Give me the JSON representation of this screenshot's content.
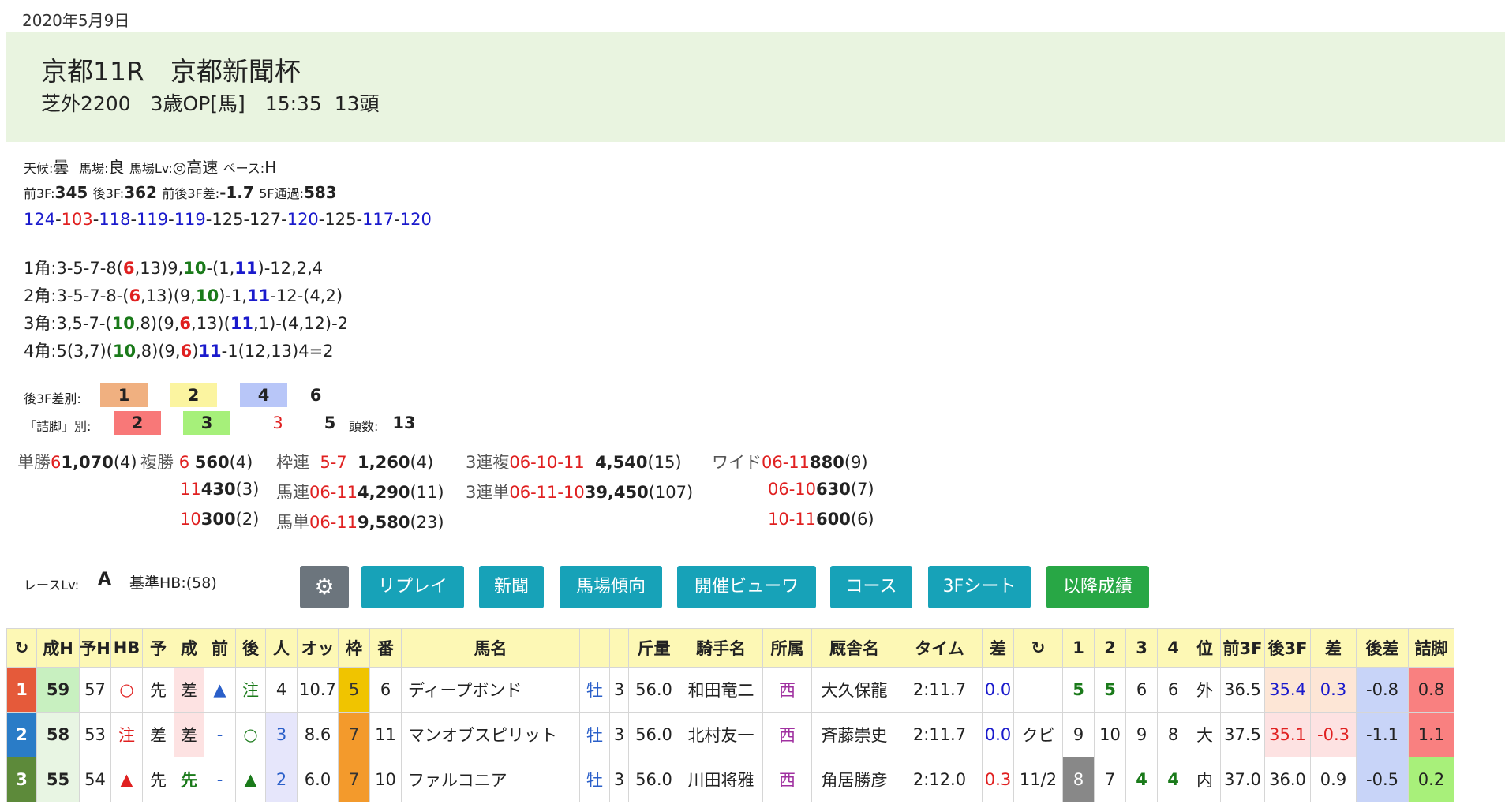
{
  "date": "2020年5月9日",
  "race": {
    "title": "京都11R　京都新聞杯",
    "sub": "芝外2200　3歳OP[馬]　15:35  13頭"
  },
  "conditions": {
    "weather_k": "天候:",
    "weather_v": "曇",
    "track_k": "馬場:",
    "track_v": "良",
    "trackLv_k": "馬場Lv:",
    "trackLv_v": "◎高速",
    "pace_k": "ペース:",
    "pace_v": "H"
  },
  "splits": {
    "f3_k": "前3F:",
    "f3_v": "345",
    "l3_k": "後3F:",
    "l3_v": "362",
    "diff_k": "前後3F差:",
    "diff_v": "-1.7",
    "f5_k": "5F通過:",
    "f5_v": "583"
  },
  "laps": [
    {
      "v": "124",
      "c": "blue"
    },
    {
      "v": "103",
      "c": "red"
    },
    {
      "v": "118",
      "c": "blue"
    },
    {
      "v": "119",
      "c": "blue"
    },
    {
      "v": "119",
      "c": "blue"
    },
    {
      "v": "125",
      "c": ""
    },
    {
      "v": "127",
      "c": ""
    },
    {
      "v": "120",
      "c": "blue"
    },
    {
      "v": "125",
      "c": ""
    },
    {
      "v": "117",
      "c": "blue"
    },
    {
      "v": "120",
      "c": "blue"
    }
  ],
  "corners": {
    "c1": "1角:3-5-7-8(6,13)9,10-(1,11)-12,2,4",
    "c2": "2角:3-5-7-8-(6,13)(9,10)-1,11-12-(4,2)",
    "c3": "3角:3,5-7-(10,8)(9,6,13)(11,1)-(4,12)-2",
    "c4": "4角:5(3,7)(10,8)(9,6)11-1(12,13)4=2"
  },
  "l3f_rank": {
    "label": "後3F差別:",
    "v1": "1",
    "v2": "2",
    "v3": "4",
    "v4": "6"
  },
  "tsume_rank": {
    "label": "「詰脚」別:",
    "v1": "2",
    "v2": "3",
    "v3": "3",
    "v4": "5",
    "count_k": "頭数:",
    "count_v": "13"
  },
  "payouts": {
    "tan_k": "単勝",
    "tan_n": "6",
    "tan_v": "1,070",
    "tan_p": "(4)",
    "fuku_k": "複勝",
    "fuku1_n": "6",
    "fuku1_v": "560",
    "fuku1_p": "(4)",
    "fuku2_n": "11",
    "fuku2_v": "430",
    "fuku2_p": "(3)",
    "fuku3_n": "10",
    "fuku3_v": "300",
    "fuku3_p": "(2)",
    "waku_k": "枠連",
    "waku_n": "5-7",
    "waku_v": "1,260",
    "waku_p": "(4)",
    "umaren_k": "馬連",
    "umaren_n": "06-11",
    "umaren_v": "4,290",
    "umaren_p": "(11)",
    "umatan_k": "馬単",
    "umatan_n": "06-11",
    "umatan_v": "9,580",
    "umatan_p": "(23)",
    "fuku3r_k": "3連複",
    "fuku3r_n": "06-10-11",
    "fuku3r_v": "4,540",
    "fuku3r_p": "(15)",
    "tan3r_k": "3連単",
    "tan3r_n": "06-11-10",
    "tan3r_v": "39,450",
    "tan3r_p": "(107)",
    "wide_k": "ワイド",
    "wide1_n": "06-11",
    "wide1_v": "880",
    "wide1_p": "(9)",
    "wide2_n": "06-10",
    "wide2_v": "630",
    "wide2_p": "(7)",
    "wide3_n": "10-11",
    "wide3_v": "600",
    "wide3_p": "(6)"
  },
  "raceLv": {
    "k": "レースLv:",
    "v": "A",
    "hb": "基準HB:(58)"
  },
  "buttons": {
    "settings": "⚙",
    "replay": "リプレイ",
    "news": "新聞",
    "track": "馬場傾向",
    "viewer": "開催ビューワ",
    "course": "コース",
    "sheet": "3Fシート",
    "after": "以降成績"
  },
  "table": {
    "headers": [
      "↻",
      "成H",
      "予H",
      "HB",
      "予",
      "成",
      "前",
      "後",
      "人",
      "オッ",
      "枠",
      "番",
      "馬名",
      "",
      "",
      "斤量",
      "騎手名",
      "所属",
      "厩舎名",
      "タイム",
      "差",
      "↻",
      "1",
      "2",
      "3",
      "4",
      "位",
      "前3F",
      "後3F",
      "差",
      "後差",
      "詰脚"
    ],
    "rows": [
      [
        "1",
        "59",
        "57",
        "○",
        "先",
        "差",
        "▲",
        "注",
        "4",
        "10.7",
        "5",
        "6",
        "ディープボンド",
        "牡",
        "3",
        "56.0",
        "和田竜二",
        "西",
        "大久保龍",
        "2:11.7",
        "0.0",
        "",
        "5",
        "5",
        "6",
        "6",
        "外",
        "36.5",
        "35.4",
        "0.3",
        "-0.8",
        "0.8"
      ],
      [
        "2",
        "58",
        "53",
        "注",
        "差",
        "差",
        "-",
        "○",
        "3",
        "8.6",
        "7",
        "11",
        "マンオブスピリット",
        "牡",
        "3",
        "56.0",
        "北村友一",
        "西",
        "斉藤崇史",
        "2:11.7",
        "0.0",
        "クビ",
        "9",
        "10",
        "9",
        "8",
        "大",
        "37.5",
        "35.1",
        "-0.3",
        "-1.1",
        "1.1"
      ],
      [
        "3",
        "55",
        "54",
        "▲",
        "先",
        "先",
        "-",
        "▲",
        "2",
        "6.0",
        "7",
        "10",
        "ファルコニア",
        "牡",
        "3",
        "56.0",
        "川田将雅",
        "西",
        "角居勝彦",
        "2:12.0",
        "0.3",
        "11/2",
        "8",
        "7",
        "4",
        "4",
        "内",
        "37.0",
        "36.0",
        "0.9",
        "-0.5",
        "0.2"
      ]
    ]
  }
}
